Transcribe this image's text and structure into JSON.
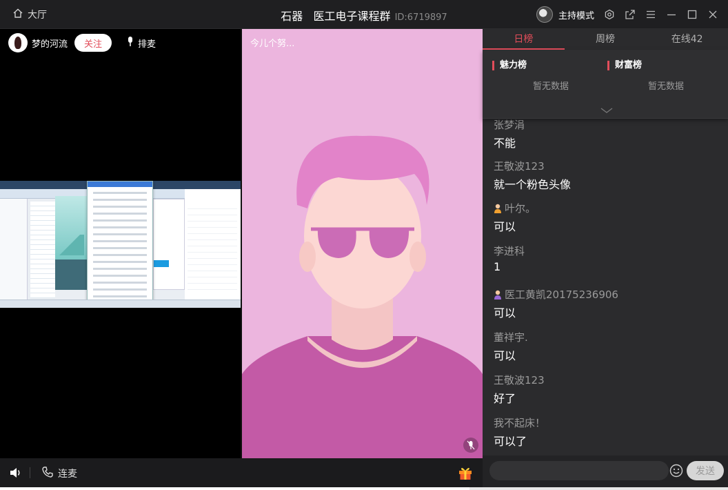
{
  "titlebar": {
    "lobby_label": "大厅",
    "room_name": "石器   医工电子课程群",
    "room_id": "ID:6719897",
    "host_mode_label": "主持模式"
  },
  "left": {
    "streamer_name": "梦的河流",
    "follow_label": "关注",
    "mic_queue_label": "排麦"
  },
  "center": {
    "caption": "今儿个努..."
  },
  "bottom": {
    "lianmai_label": "连麦"
  },
  "right": {
    "tabs": [
      {
        "label": "日榜",
        "active": true
      },
      {
        "label": "周榜",
        "active": false
      },
      {
        "label": "在线42",
        "active": false
      }
    ],
    "charm_title": "魅力榜",
    "wealth_title": "财富榜",
    "empty_text": "暂无数据",
    "messages": [
      {
        "user": "张梦涓",
        "text": "不能",
        "badge": ""
      },
      {
        "user": "王敬波123",
        "text": "就一个粉色头像",
        "badge": ""
      },
      {
        "user": "叶尔。",
        "text": "可以",
        "badge": "orange-user-icon"
      },
      {
        "user": "李进科",
        "text": "1",
        "badge": ""
      },
      {
        "user": "医工黄凯20175236906",
        "text": "可以",
        "badge": "purple-user-icon"
      },
      {
        "user": "董祥宇.",
        "text": "可以",
        "badge": ""
      },
      {
        "user": "王敬波123",
        "text": "好了",
        "badge": ""
      },
      {
        "user": "我不起床！",
        "text": "可以了",
        "badge": ""
      }
    ],
    "input_placeholder": "",
    "send_label": "发送"
  },
  "colors": {
    "accent": "#e24d5a",
    "panel_bg": "#2b2b2d",
    "pink_bg": "#ecb5de"
  }
}
